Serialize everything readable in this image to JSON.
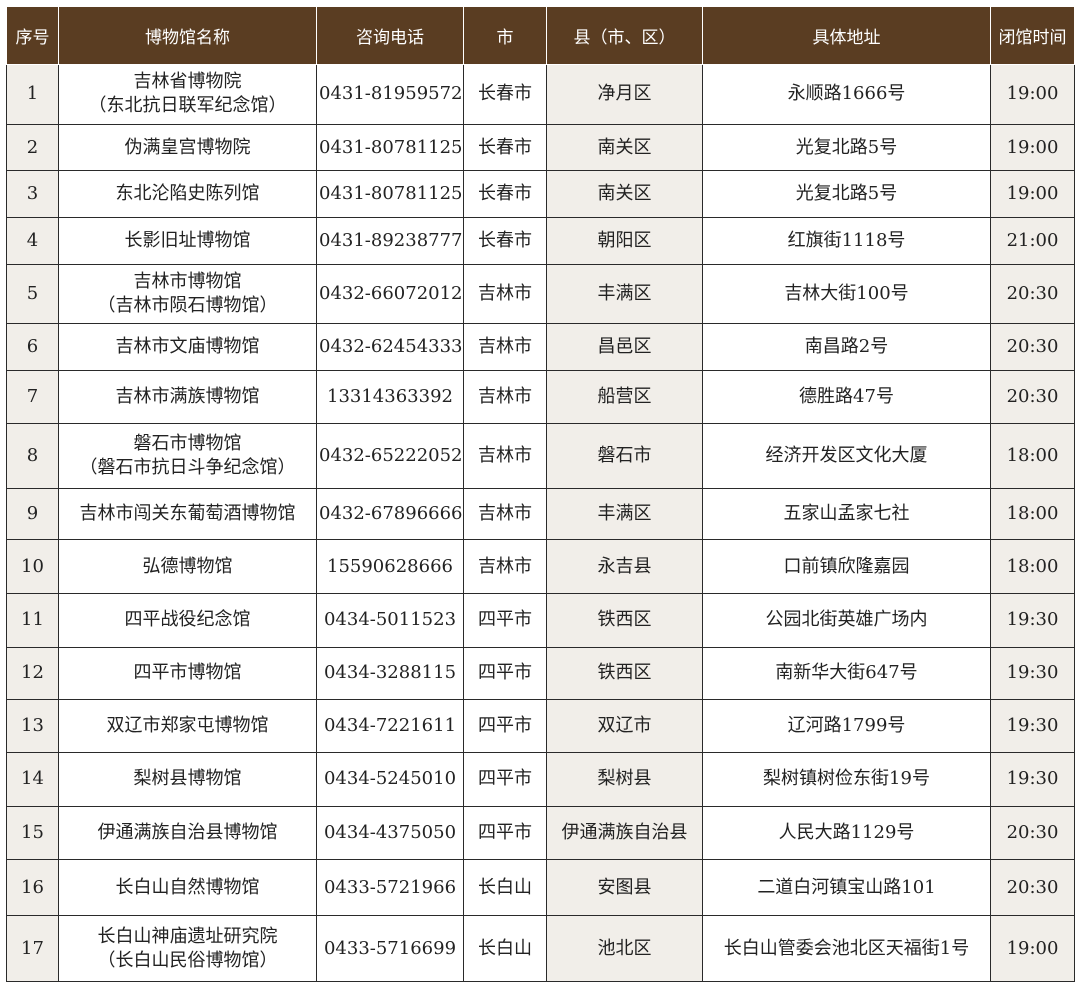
{
  "headers": [
    "序号",
    "博物馆名称",
    "咨询电话",
    "市",
    "县（市、区）",
    "具体地址",
    "闭馆时间"
  ],
  "rows": [
    {
      "no": "1",
      "name": "吉林省博物院",
      "name2": "（东北抗日联军纪念馆）",
      "phone": "0431-81959572",
      "city": "长春市",
      "district": "净月区",
      "address": "永顺路1666号",
      "close": "19:00"
    },
    {
      "no": "2",
      "name": "伪满皇宫博物院",
      "name2": "",
      "phone": "0431-80781125",
      "city": "长春市",
      "district": "南关区",
      "address": "光复北路5号",
      "close": "19:00"
    },
    {
      "no": "3",
      "name": "东北沦陷史陈列馆",
      "name2": "",
      "phone": "0431-80781125",
      "city": "长春市",
      "district": "南关区",
      "address": "光复北路5号",
      "close": "19:00"
    },
    {
      "no": "4",
      "name": "长影旧址博物馆",
      "name2": "",
      "phone": "0431-89238777",
      "city": "长春市",
      "district": "朝阳区",
      "address": "红旗街1118号",
      "close": "21:00"
    },
    {
      "no": "5",
      "name": "吉林市博物馆",
      "name2": "（吉林市陨石博物馆）",
      "phone": "0432-66072012",
      "city": "吉林市",
      "district": "丰满区",
      "address": "吉林大街100号",
      "close": "20:30"
    },
    {
      "no": "6",
      "name": "吉林市文庙博物馆",
      "name2": "",
      "phone": "0432-62454333",
      "city": "吉林市",
      "district": "昌邑区",
      "address": "南昌路2号",
      "close": "20:30"
    },
    {
      "no": "7",
      "name": "吉林市满族博物馆",
      "name2": "",
      "phone": "13314363392",
      "city": "吉林市",
      "district": "船营区",
      "address": "德胜路47号",
      "close": "20:30"
    },
    {
      "no": "8",
      "name": "磐石市博物馆",
      "name2": "（磐石市抗日斗争纪念馆）",
      "phone": "0432-65222052",
      "city": "吉林市",
      "district": "磐石市",
      "address": "经济开发区文化大厦",
      "close": "18:00"
    },
    {
      "no": "9",
      "name": "吉林市闯关东葡萄酒博物馆",
      "name2": "",
      "phone": "0432-67896666",
      "city": "吉林市",
      "district": "丰满区",
      "address": "五家山孟家七社",
      "close": "18:00"
    },
    {
      "no": "10",
      "name": "弘德博物馆",
      "name2": "",
      "phone": "15590628666",
      "city": "吉林市",
      "district": "永吉县",
      "address": "口前镇欣隆嘉园",
      "close": "18:00"
    },
    {
      "no": "11",
      "name": "四平战役纪念馆",
      "name2": "",
      "phone": "0434-5011523",
      "city": "四平市",
      "district": "铁西区",
      "address": "公园北街英雄广场内",
      "close": "19:30"
    },
    {
      "no": "12",
      "name": "四平市博物馆",
      "name2": "",
      "phone": "0434-3288115",
      "city": "四平市",
      "district": "铁西区",
      "address": "南新华大街647号",
      "close": "19:30"
    },
    {
      "no": "13",
      "name": "双辽市郑家屯博物馆",
      "name2": "",
      "phone": "0434-7221611",
      "city": "四平市",
      "district": "双辽市",
      "address": "辽河路1799号",
      "close": "19:30"
    },
    {
      "no": "14",
      "name": "梨树县博物馆",
      "name2": "",
      "phone": "0434-5245010",
      "city": "四平市",
      "district": "梨树县",
      "address": "梨树镇树俭东街19号",
      "close": "19:30"
    },
    {
      "no": "15",
      "name": "伊通满族自治县博物馆",
      "name2": "",
      "phone": "0434-4375050",
      "city": "四平市",
      "district": "伊通满族自治县",
      "address": "人民大路1129号",
      "close": "20:30"
    },
    {
      "no": "16",
      "name": "长白山自然博物馆",
      "name2": "",
      "phone": "0433-5721966",
      "city": "长白山",
      "district": "安图县",
      "address": "二道白河镇宝山路101",
      "close": "20:30"
    },
    {
      "no": "17",
      "name": "长白山神庙遗址研究院",
      "name2": "（长白山民俗博物馆）",
      "phone": "0433-5716699",
      "city": "长白山",
      "district": "池北区",
      "address": "长白山管委会池北区天福街1号",
      "close": "19:00"
    }
  ],
  "colors": {
    "header_bg": "#5a3d22",
    "header_text": "#ffffff",
    "shade": "#f1eee9",
    "border": "#2a2a2a"
  }
}
